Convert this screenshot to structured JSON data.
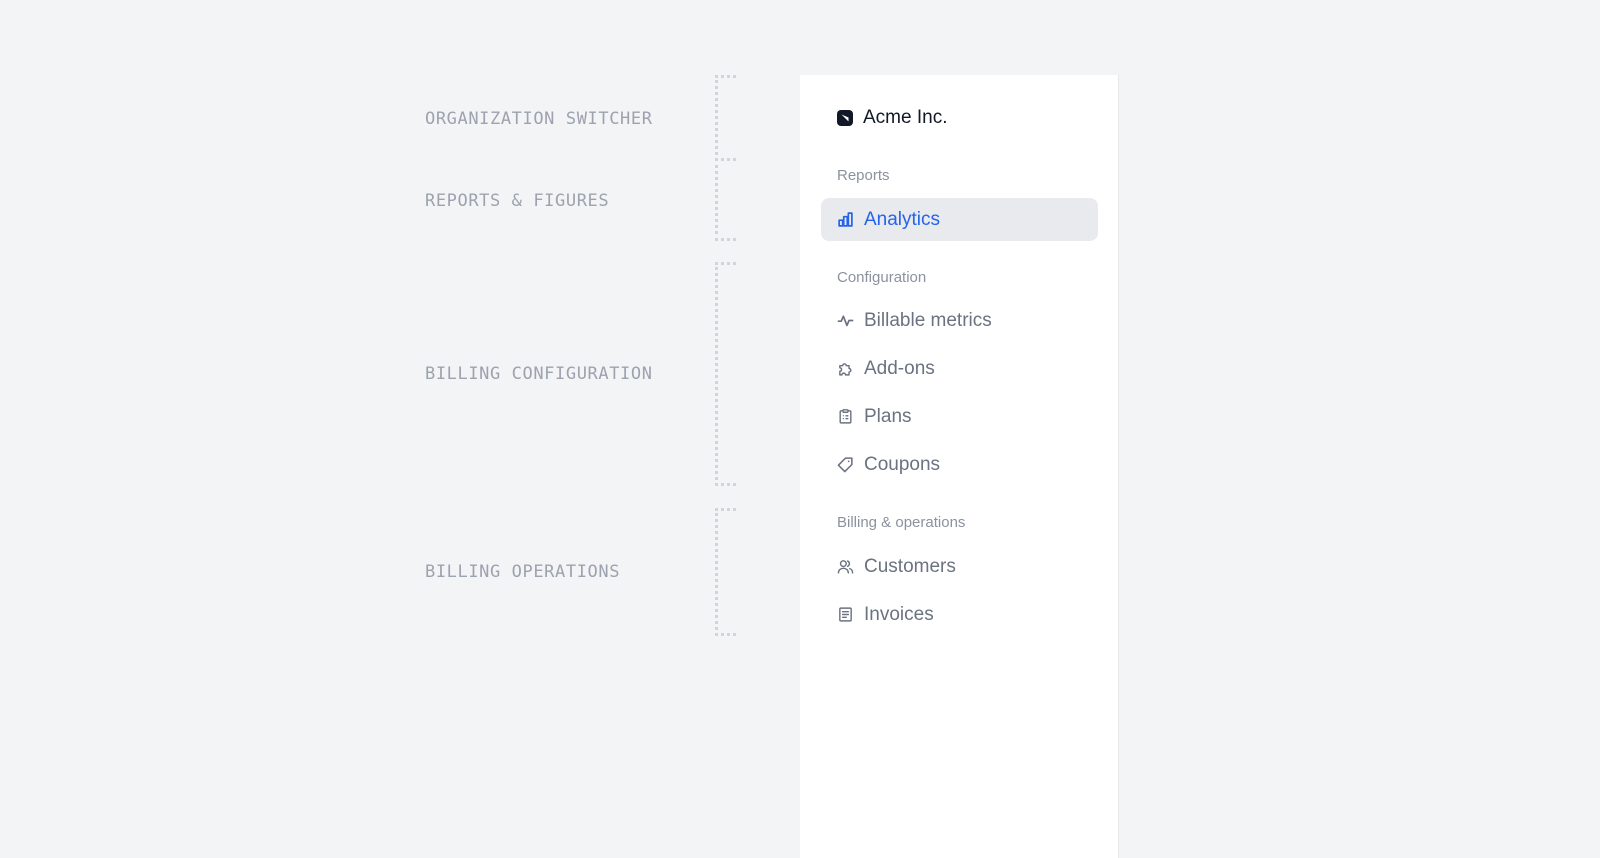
{
  "annotations": [
    {
      "label": "ORGANIZATION SWITCHER"
    },
    {
      "label": "REPORTS & FIGURES"
    },
    {
      "label": "BILLING CONFIGURATION"
    },
    {
      "label": "BILLING OPERATIONS"
    }
  ],
  "sidebar": {
    "org_name": "Acme Inc.",
    "sections": {
      "reports": {
        "label": "Reports",
        "items": [
          {
            "label": "Analytics",
            "icon": "bar-chart-icon",
            "active": true
          }
        ]
      },
      "configuration": {
        "label": "Configuration",
        "items": [
          {
            "label": "Billable metrics",
            "icon": "pulse-icon"
          },
          {
            "label": "Add-ons",
            "icon": "puzzle-icon"
          },
          {
            "label": "Plans",
            "icon": "clipboard-icon"
          },
          {
            "label": "Coupons",
            "icon": "tag-icon"
          }
        ]
      },
      "operations": {
        "label": "Billing & operations",
        "items": [
          {
            "label": "Customers",
            "icon": "users-icon"
          },
          {
            "label": "Invoices",
            "icon": "document-icon"
          }
        ]
      }
    }
  },
  "colors": {
    "background": "#f3f4f6",
    "sidebar": "#ffffff",
    "accent": "#2563eb",
    "active_bg": "#e8eaed",
    "muted_text": "#6b7280",
    "annotation_text": "#9ca3af"
  }
}
